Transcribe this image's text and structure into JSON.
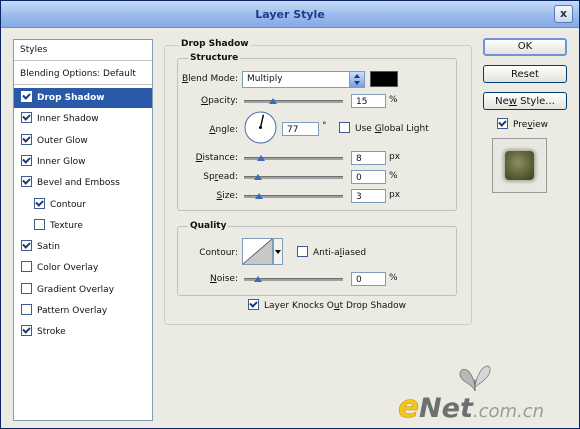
{
  "window": {
    "title": "Layer Style",
    "close_label": "x"
  },
  "styles_panel": {
    "header": "Styles",
    "blending_options": "Blending Options: Default",
    "items": [
      {
        "label": "Drop Shadow",
        "checked": true,
        "selected": true
      },
      {
        "label": "Inner Shadow",
        "checked": true
      },
      {
        "label": "Outer Glow",
        "checked": true
      },
      {
        "label": "Inner Glow",
        "checked": true
      },
      {
        "label": "Bevel and Emboss",
        "checked": true
      },
      {
        "label": "Contour",
        "checked": true,
        "indent": true
      },
      {
        "label": "Texture",
        "checked": false,
        "indent": true
      },
      {
        "label": "Satin",
        "checked": true
      },
      {
        "label": "Color Overlay",
        "checked": false
      },
      {
        "label": "Gradient Overlay",
        "checked": false
      },
      {
        "label": "Pattern Overlay",
        "checked": false
      },
      {
        "label": "Stroke",
        "checked": true
      }
    ]
  },
  "drop_shadow": {
    "title": "Drop Shadow",
    "structure": {
      "title": "Structure",
      "blend_mode": {
        "label_u": "B",
        "label_rest": "lend Mode:",
        "value": "Multiply",
        "color": "#000000"
      },
      "opacity": {
        "label_u": "O",
        "label_rest": "pacity:",
        "value": "15",
        "unit": "%",
        "fraction": 0.15
      },
      "angle": {
        "label_u": "A",
        "label_rest": "ngle:",
        "value": "77",
        "unit": "°",
        "degrees": 77
      },
      "use_global_light": {
        "label_pre": "Use ",
        "label_u": "G",
        "label_rest": "lobal Light",
        "checked": false
      },
      "distance": {
        "label_u": "D",
        "label_rest": "istance:",
        "value": "8",
        "unit": "px",
        "fraction": 0.027
      },
      "spread": {
        "label_pre": "Sp",
        "label_u": "r",
        "label_rest": "ead:",
        "value": "0",
        "unit": "%",
        "fraction": 0
      },
      "size": {
        "label_u": "S",
        "label_rest": "ize:",
        "value": "3",
        "unit": "px",
        "fraction": 0.015
      }
    },
    "quality": {
      "title": "Quality",
      "contour_label": "Contour:",
      "anti_aliased": {
        "label_pre": "Anti-a",
        "label_u": "l",
        "label_rest": "iased",
        "checked": false
      },
      "noise": {
        "label_u": "N",
        "label_rest": "oise:",
        "value": "0",
        "unit": "%",
        "fraction": 0
      }
    },
    "knocks_out": {
      "label_pre": "Layer Knocks O",
      "label_u": "u",
      "label_rest": "t Drop Shadow",
      "checked": true
    }
  },
  "buttons": {
    "ok": "OK",
    "reset": "Reset",
    "new_style_pre": "Ne",
    "new_style_u": "w",
    "new_style_rest": " Style...",
    "preview_pre": "Pre",
    "preview_u": "v",
    "preview_rest": "iew",
    "preview_checked": true
  },
  "watermark": {
    "text": "eNet.com.cn",
    "e": "e",
    "net": "Net",
    "dotcom": ".com.cn"
  },
  "colors": {
    "accent": "#2a5aa7",
    "title_text": "#1f3c8c",
    "dialog_bg": "#ecebe3",
    "preview_swatch": "#6b6f45"
  }
}
